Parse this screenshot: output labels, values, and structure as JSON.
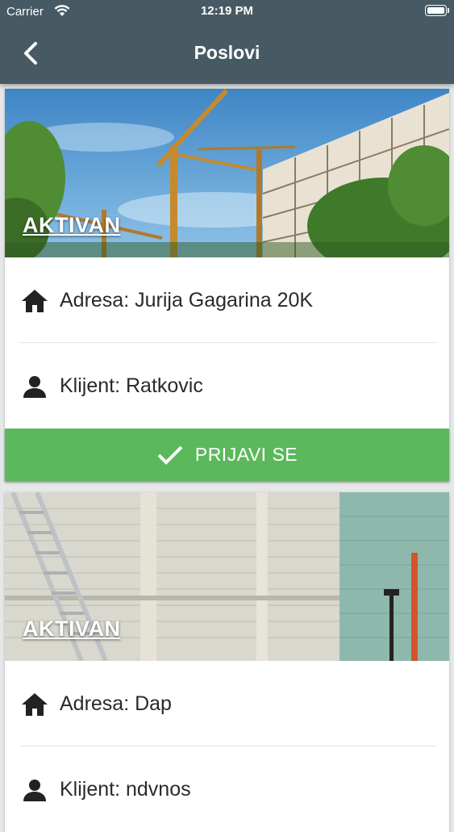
{
  "status_bar": {
    "carrier": "Carrier",
    "time": "12:19 PM"
  },
  "header": {
    "title": "Poslovi"
  },
  "jobs": [
    {
      "status": "AKTIVAN",
      "image": "construction-cranes-building",
      "address": "Adresa: Jurija Gagarina 20K",
      "client": "Klijent: Ratkovic",
      "action_label": "PRIJAVI SE"
    },
    {
      "status": "AKTIVAN",
      "image": "interior-brick-wall-renovation",
      "address": "Adresa: Dap",
      "client": "Klijent: ndvnos"
    }
  ],
  "colors": {
    "header": "#475a64",
    "action_button": "#5cb85c",
    "background": "#e6e7e8"
  }
}
